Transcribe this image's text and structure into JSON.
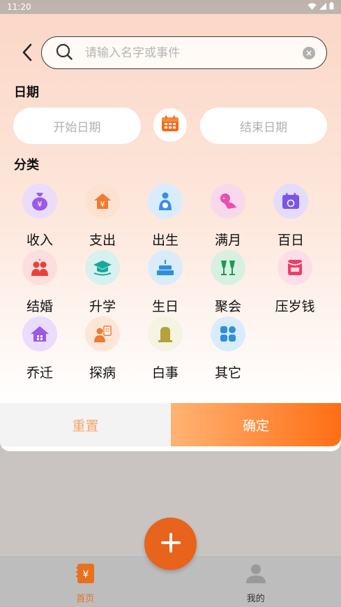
{
  "status_bar": {
    "time": "11:20"
  },
  "search": {
    "placeholder": "请输入名字或事件",
    "value": ""
  },
  "date": {
    "section_title": "日期",
    "start_placeholder": "开始日期",
    "end_placeholder": "结束日期"
  },
  "category": {
    "section_title": "分类",
    "items": [
      {
        "label": "收入",
        "icon": "money-bag-icon",
        "bg": "#eadcfb"
      },
      {
        "label": "支出",
        "icon": "house-yen-icon",
        "bg": "#fde2d2"
      },
      {
        "label": "出生",
        "icon": "baby-icon",
        "bg": "#d9ecfb"
      },
      {
        "label": "满月",
        "icon": "baby-crawl-icon",
        "bg": "#f8d9ec"
      },
      {
        "label": "百日",
        "icon": "calendar-day-icon",
        "bg": "#e4dcfb"
      },
      {
        "label": "结婚",
        "icon": "couple-icon",
        "bg": "#fbdede"
      },
      {
        "label": "升学",
        "icon": "graduation-cap-icon",
        "bg": "#d6f1ee"
      },
      {
        "label": "生日",
        "icon": "cake-icon",
        "bg": "#d9ecfb"
      },
      {
        "label": "聚会",
        "icon": "cheers-icon",
        "bg": "#d8f0e0"
      },
      {
        "label": "压岁钱",
        "icon": "red-envelope-icon",
        "bg": "#fbdee6"
      },
      {
        "label": "乔迁",
        "icon": "new-home-icon",
        "bg": "#eadcfb"
      },
      {
        "label": "探病",
        "icon": "visit-patient-icon",
        "bg": "#fde6d8"
      },
      {
        "label": "白事",
        "icon": "tombstone-icon",
        "bg": "#f5f3e2"
      },
      {
        "label": "其它",
        "icon": "grid-apps-icon",
        "bg": "#d9ecfb"
      }
    ]
  },
  "actions": {
    "reset_label": "重置",
    "confirm_label": "确定"
  },
  "nav": {
    "items": [
      {
        "label": "首页",
        "icon": "ledger-icon"
      },
      {
        "label": "我的",
        "icon": "person-icon"
      }
    ]
  },
  "colors": {
    "accent": "#ff6e14",
    "accent_light": "#ffb373"
  }
}
